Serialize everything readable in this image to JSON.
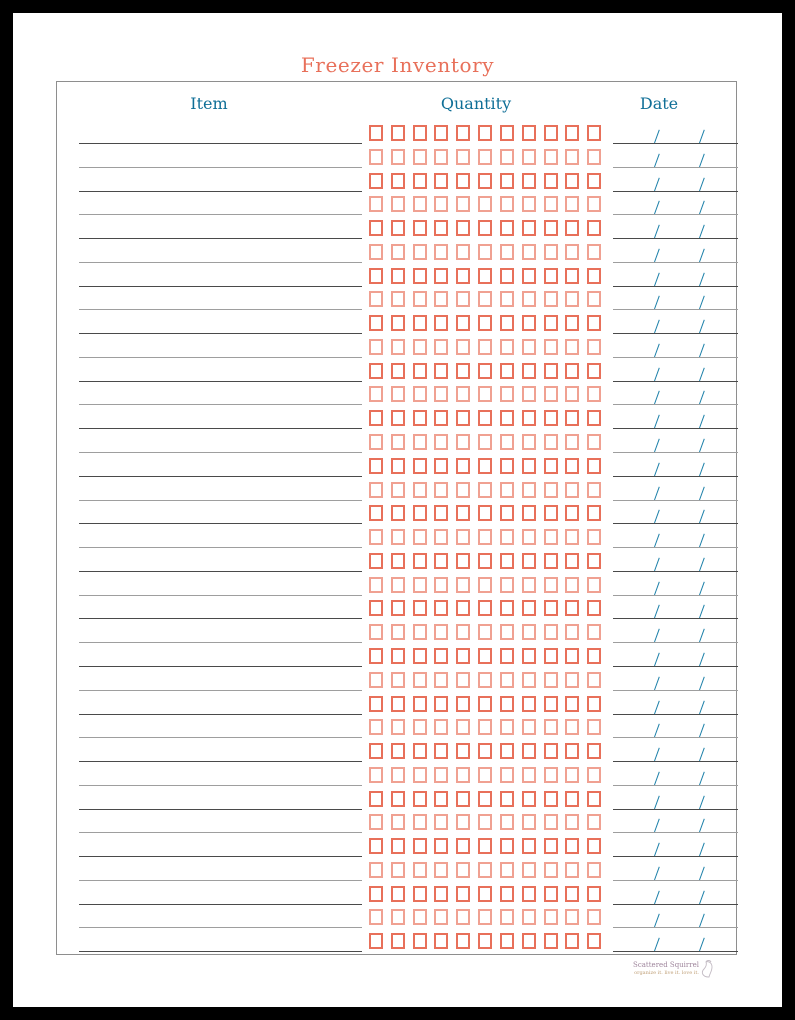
{
  "page": {
    "title": "Freezer Inventory",
    "title_color": "#E8705A",
    "background": "#ffffff",
    "outer_border_color": "#000000"
  },
  "table": {
    "border_color": "#8e8e8e",
    "columns": [
      {
        "key": "item",
        "label": "Item",
        "color": "#0f6f97"
      },
      {
        "key": "quantity",
        "label": "Quantity",
        "color": "#0f6f97"
      },
      {
        "key": "date",
        "label": "Date",
        "color": "#0f6f97"
      }
    ],
    "row_count": 35,
    "checkboxes_per_row": 11,
    "checkbox_color": "#E8705A",
    "checkbox_color_alt": "#F0A192",
    "date_slashes_per_row": 2,
    "date_slash_color": "#1b7fa8",
    "line_color": "#4a4a4a",
    "line_color_alt": "#9e9e9e",
    "rows": [
      {
        "item": "",
        "quantity": "",
        "date": ""
      },
      {
        "item": "",
        "quantity": "",
        "date": ""
      },
      {
        "item": "",
        "quantity": "",
        "date": ""
      },
      {
        "item": "",
        "quantity": "",
        "date": ""
      },
      {
        "item": "",
        "quantity": "",
        "date": ""
      },
      {
        "item": "",
        "quantity": "",
        "date": ""
      },
      {
        "item": "",
        "quantity": "",
        "date": ""
      },
      {
        "item": "",
        "quantity": "",
        "date": ""
      },
      {
        "item": "",
        "quantity": "",
        "date": ""
      },
      {
        "item": "",
        "quantity": "",
        "date": ""
      },
      {
        "item": "",
        "quantity": "",
        "date": ""
      },
      {
        "item": "",
        "quantity": "",
        "date": ""
      },
      {
        "item": "",
        "quantity": "",
        "date": ""
      },
      {
        "item": "",
        "quantity": "",
        "date": ""
      },
      {
        "item": "",
        "quantity": "",
        "date": ""
      },
      {
        "item": "",
        "quantity": "",
        "date": ""
      },
      {
        "item": "",
        "quantity": "",
        "date": ""
      },
      {
        "item": "",
        "quantity": "",
        "date": ""
      },
      {
        "item": "",
        "quantity": "",
        "date": ""
      },
      {
        "item": "",
        "quantity": "",
        "date": ""
      },
      {
        "item": "",
        "quantity": "",
        "date": ""
      },
      {
        "item": "",
        "quantity": "",
        "date": ""
      },
      {
        "item": "",
        "quantity": "",
        "date": ""
      },
      {
        "item": "",
        "quantity": "",
        "date": ""
      },
      {
        "item": "",
        "quantity": "",
        "date": ""
      },
      {
        "item": "",
        "quantity": "",
        "date": ""
      },
      {
        "item": "",
        "quantity": "",
        "date": ""
      },
      {
        "item": "",
        "quantity": "",
        "date": ""
      },
      {
        "item": "",
        "quantity": "",
        "date": ""
      },
      {
        "item": "",
        "quantity": "",
        "date": ""
      },
      {
        "item": "",
        "quantity": "",
        "date": ""
      },
      {
        "item": "",
        "quantity": "",
        "date": ""
      },
      {
        "item": "",
        "quantity": "",
        "date": ""
      },
      {
        "item": "",
        "quantity": "",
        "date": ""
      },
      {
        "item": "",
        "quantity": "",
        "date": ""
      }
    ]
  },
  "watermark": {
    "brand": "Scattered Squirrel",
    "tagline": "organize it. live it. love it.",
    "icon": "squirrel-icon"
  }
}
